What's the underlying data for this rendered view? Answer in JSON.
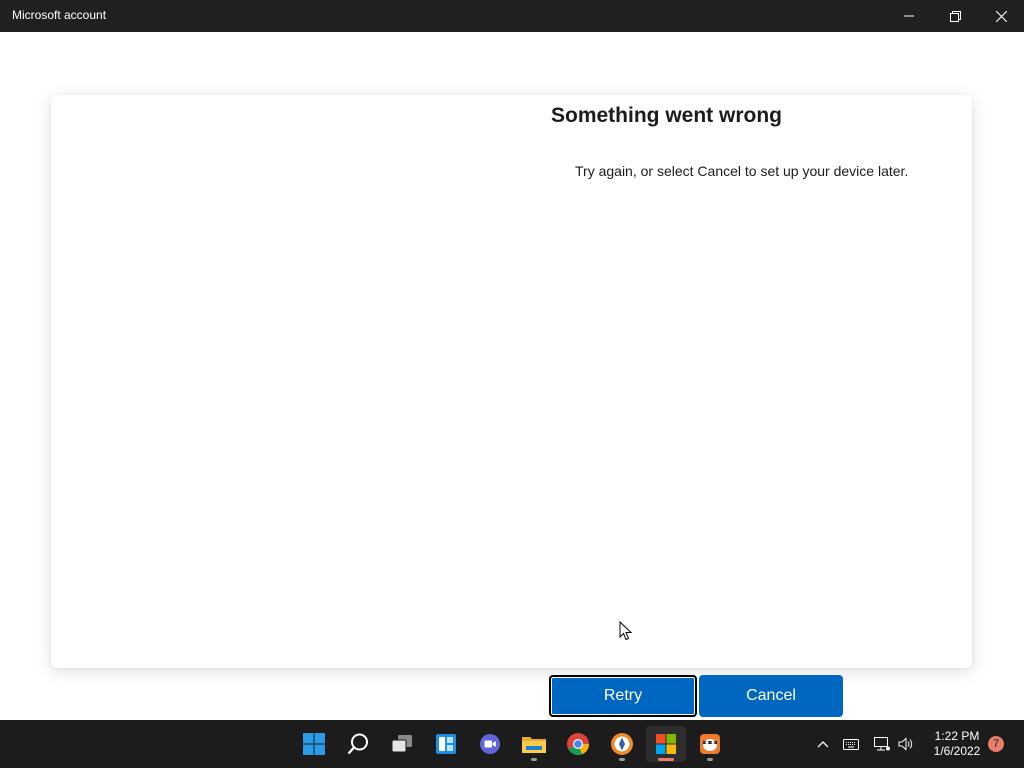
{
  "window": {
    "title": "Microsoft account",
    "controls": [
      "minimize",
      "restore",
      "close"
    ]
  },
  "dialog": {
    "heading": "Something went wrong",
    "message": "Try again, or select Cancel to set up your device later."
  },
  "buttons": {
    "retry": "Retry",
    "cancel": "Cancel"
  },
  "taskbar": {
    "apps": [
      "start-icon",
      "search-icon",
      "task-view-icon",
      "widgets-icon",
      "teams-chat-icon",
      "file-explorer-icon",
      "chrome-icon",
      "brave-icon",
      "microsoft-store-icon",
      "app-icon"
    ],
    "clock": {
      "time": "1:22 PM",
      "date": "1/6/2022"
    },
    "notification_count": "7"
  },
  "colors": {
    "accent": "#0067c0",
    "titlebar": "#202020",
    "taskbar": "#1c1c1c",
    "badge": "#e97f6b"
  }
}
